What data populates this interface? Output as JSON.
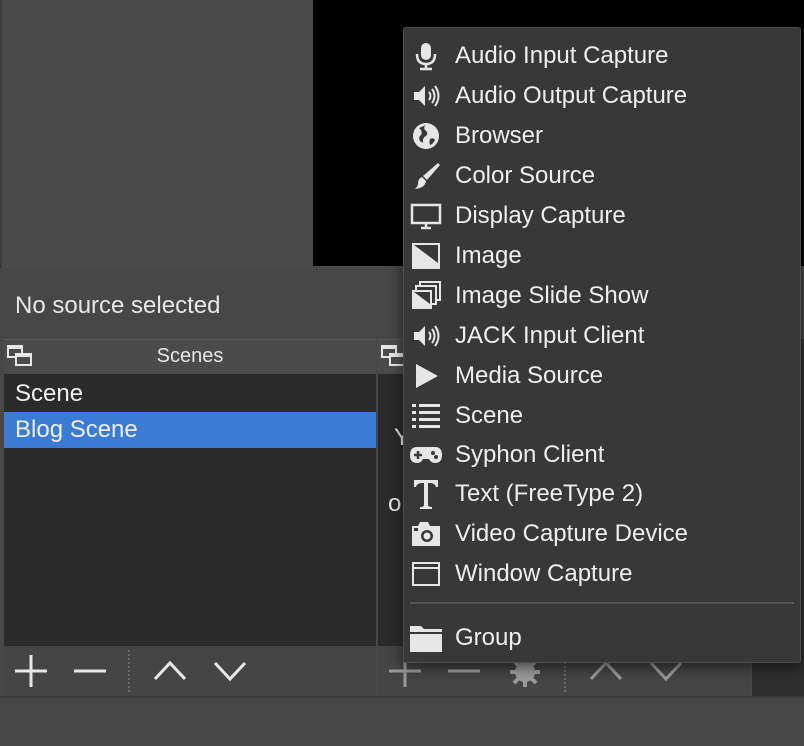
{
  "source_status": {
    "label": "No source selected"
  },
  "scenes_dock": {
    "title": "Scenes",
    "items": [
      {
        "label": "Scene",
        "selected": false
      },
      {
        "label": "Blog Scene",
        "selected": true
      }
    ],
    "toolbar": {
      "add_icon": "plus-icon",
      "remove_icon": "minus-icon",
      "up_icon": "chevron-up-icon",
      "down_icon": "chevron-down-icon"
    }
  },
  "sources_dock": {
    "peek_text_1": "Y",
    "peek_text_2": "o",
    "toolbar": {
      "add_icon": "plus-icon",
      "remove_icon": "minus-icon",
      "properties_icon": "gear-icon",
      "up_icon": "chevron-up-icon",
      "down_icon": "chevron-down-icon"
    }
  },
  "add_source_menu": {
    "items": [
      {
        "label": "Audio Input Capture",
        "icon": "microphone-icon"
      },
      {
        "label": "Audio Output Capture",
        "icon": "speaker-icon"
      },
      {
        "label": "Browser",
        "icon": "globe-icon"
      },
      {
        "label": "Color Source",
        "icon": "paintbrush-icon"
      },
      {
        "label": "Display Capture",
        "icon": "monitor-icon"
      },
      {
        "label": "Image",
        "icon": "image-icon"
      },
      {
        "label": "Image Slide Show",
        "icon": "slideshow-icon"
      },
      {
        "label": "JACK Input Client",
        "icon": "speaker-icon"
      },
      {
        "label": "Media Source",
        "icon": "play-icon"
      },
      {
        "label": "Scene",
        "icon": "list-icon"
      },
      {
        "label": "Syphon Client",
        "icon": "gamepad-icon"
      },
      {
        "label": "Text (FreeType 2)",
        "icon": "text-icon"
      },
      {
        "label": "Video Capture Device",
        "icon": "camera-icon"
      },
      {
        "label": "Window Capture",
        "icon": "window-icon"
      }
    ],
    "group_item": {
      "label": "Group",
      "icon": "folder-icon"
    }
  },
  "colors": {
    "selection": "#3a7bd5",
    "menu_bg": "#383838",
    "list_bg": "#2b2b2b"
  }
}
